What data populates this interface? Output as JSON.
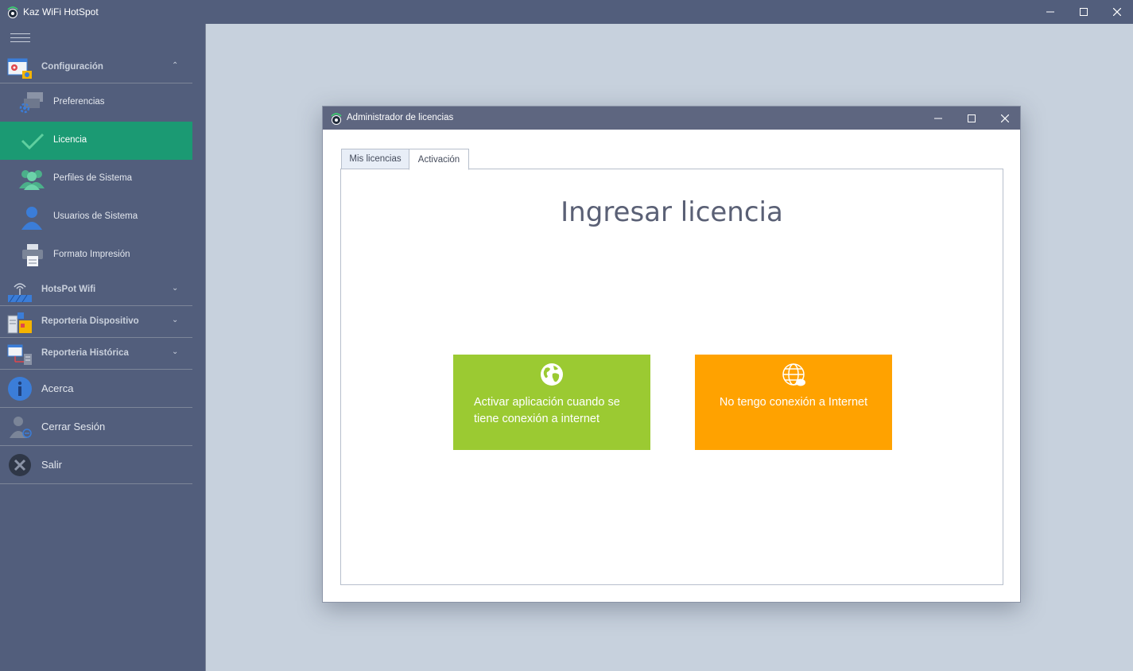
{
  "app": {
    "title": "Kaz WiFi HotSpot",
    "icon": "wifi-logo-icon"
  },
  "sidebar": {
    "groups": [
      {
        "label": "Configuración",
        "icon": "settings-window-icon",
        "chevron": "chevron-up-icon"
      },
      {
        "label": "HotsPot Wifi",
        "icon": "router-icon",
        "chevron": "chevron-down-icon"
      },
      {
        "label": "Reporteria Dispositivo",
        "icon": "device-report-icon",
        "chevron": "chevron-down-icon"
      },
      {
        "label": "Reporteria Histórica",
        "icon": "history-report-icon",
        "chevron": "chevron-down-icon"
      }
    ],
    "items": [
      {
        "label": "Preferencias",
        "icon": "preferences-icon"
      },
      {
        "label": "Licencia",
        "icon": "checkmark-icon",
        "active": true
      },
      {
        "label": "Perfiles de Sistema",
        "icon": "user-group-icon"
      },
      {
        "label": "Usuarios de Sistema",
        "icon": "user-icon"
      },
      {
        "label": "Formato Impresión",
        "icon": "printer-icon"
      }
    ],
    "bottom": [
      {
        "label": "Acerca",
        "icon": "info-icon"
      },
      {
        "label": "Cerrar Sesión",
        "icon": "logout-user-icon"
      },
      {
        "label": "Salir",
        "icon": "exit-icon"
      }
    ],
    "active_color": "#1b9a73"
  },
  "dialog": {
    "title": "Administrador de licencias",
    "tabs": [
      {
        "label": "Mis licencias"
      },
      {
        "label": "Activación",
        "selected": true
      }
    ],
    "heading": "Ingresar licencia",
    "tiles": [
      {
        "label": "Activar aplicación cuando se tiene conexión a internet",
        "icon": "globe-icon",
        "color": "#9bca32"
      },
      {
        "label": "No tengo conexión a Internet",
        "icon": "globe-offline-icon",
        "color": "#ffa200"
      }
    ]
  }
}
